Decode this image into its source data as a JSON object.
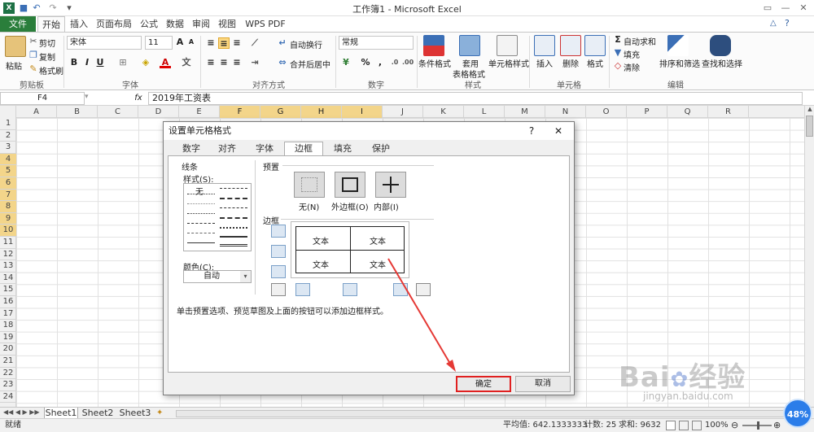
{
  "window": {
    "title": "工作簿1 - Microsoft Excel"
  },
  "ribbon_tabs": [
    "文件",
    "开始",
    "插入",
    "页面布局",
    "公式",
    "数据",
    "审阅",
    "视图",
    "WPS PDF"
  ],
  "ribbon": {
    "clipboard": {
      "paste": "粘贴",
      "cut": "剪切",
      "copy": "复制",
      "format_painter": "格式刷",
      "label": "剪贴板"
    },
    "font": {
      "name": "宋体",
      "size": "11",
      "label": "字体",
      "bold": "B",
      "italic": "I",
      "underline": "U",
      "font_color_glyph": "A",
      "grow_glyph": "A",
      "shrink_glyph": "A"
    },
    "alignment": {
      "wrap": "自动换行",
      "merge": "合并后居中",
      "label": "对齐方式"
    },
    "number": {
      "format": "常规",
      "percent": "%",
      "comma": ",",
      "label": "数字"
    },
    "styles": {
      "conditional": "条件格式",
      "table_fmt_1": "套用",
      "table_fmt_2": "表格格式",
      "cell_style": "单元格样式",
      "label": "样式"
    },
    "cells": {
      "insert": "插入",
      "delete": "删除",
      "format": "格式",
      "label": "单元格"
    },
    "editing": {
      "autosum": "自动求和",
      "fill": "填充",
      "clear": "清除",
      "sort": "排序和筛选",
      "find": "查找和选择",
      "label": "编辑"
    }
  },
  "formula_bar": {
    "name_box": "F4",
    "fx": "fx",
    "content": "2019年工资表"
  },
  "columns": [
    "A",
    "B",
    "C",
    "D",
    "E",
    "F",
    "G",
    "H",
    "I",
    "J",
    "K",
    "L",
    "M",
    "N",
    "O",
    "P",
    "Q",
    "R"
  ],
  "rows": [
    "1",
    "2",
    "3",
    "4",
    "5",
    "6",
    "7",
    "8",
    "9",
    "10",
    "11",
    "12",
    "13",
    "14",
    "15",
    "16",
    "17",
    "18",
    "19",
    "20",
    "21",
    "22",
    "23",
    "24"
  ],
  "sheets": [
    "Sheet1",
    "Sheet2",
    "Sheet3"
  ],
  "status": {
    "ready": "就绪",
    "average": "平均值: 642.1333333",
    "count": "计数: 25",
    "sum": "求和: 9632",
    "zoom": "100%"
  },
  "dialog": {
    "title": "设置单元格格式",
    "help": "?",
    "close": "✕",
    "tabs": [
      "数字",
      "对齐",
      "字体",
      "边框",
      "填充",
      "保护"
    ],
    "line_group": "线条",
    "style_label": "样式(S):",
    "style_none": "无",
    "color_label": "颜色(C):",
    "color_value": "自动",
    "presets_group": "预置",
    "presets": [
      "无(N)",
      "外边框(O)",
      "内部(I)"
    ],
    "border_group": "边框",
    "preview_cells": [
      "文本",
      "文本",
      "文本",
      "文本"
    ],
    "hint": "单击预置选项、预览草图及上面的按钮可以添加边框样式。",
    "ok": "确定",
    "cancel": "取消"
  },
  "watermark": {
    "brand": "Bai",
    "brand2": "经验",
    "url": "jingyan.baidu.com"
  },
  "badge": "48%"
}
